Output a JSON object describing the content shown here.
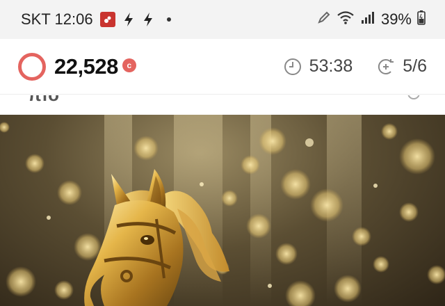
{
  "status_bar": {
    "carrier_time": "SKT 12:06",
    "battery": "39%",
    "icons": [
      "app-notification-icon",
      "bolt-icon",
      "bolt-icon",
      "more-dot-icon",
      "pencil-icon",
      "wifi-icon",
      "signal-icon",
      "battery-icon"
    ]
  },
  "header": {
    "points": "22,528",
    "coin_symbol": "c",
    "timer": "53:38",
    "progress": "5/6",
    "accent_color": "#e4645f"
  },
  "content": {
    "cut_title": "πlo",
    "image_alt": "golden horse statue with bokeh lights"
  }
}
